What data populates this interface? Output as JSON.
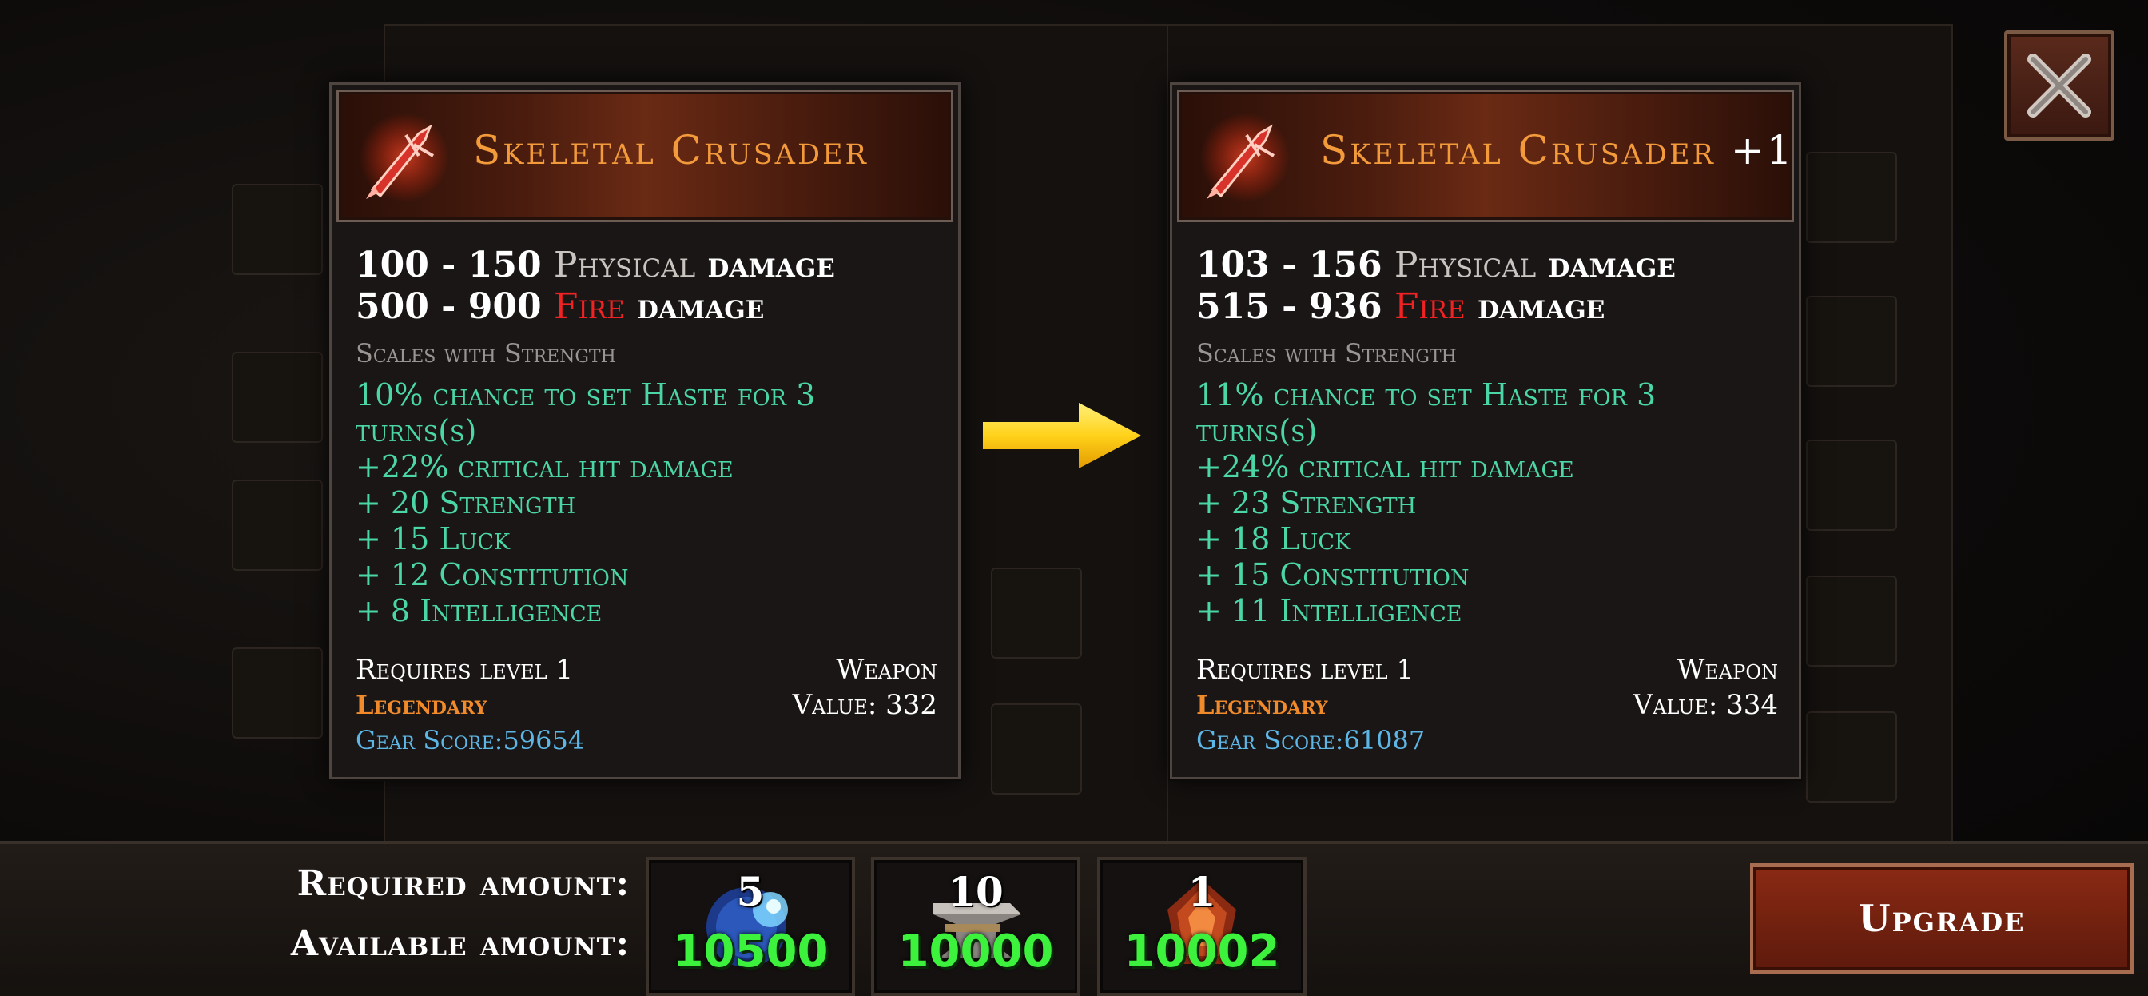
{
  "colors": {
    "title": "#f39a3a",
    "fire": "#f22222",
    "stat": "#4ad6a7",
    "legendary": "#f08a2a",
    "gear_score": "#5db7e6",
    "available": "#3cf23c"
  },
  "close_icon": "close-x-icon",
  "current_item": {
    "name": "Skeletal Crusader",
    "damage": [
      {
        "range": "100 - 150",
        "type": "Physical",
        "suffix": "damage"
      },
      {
        "range": "500 - 900",
        "type": "Fire",
        "suffix": "damage"
      }
    ],
    "scales": "Scales with Strength",
    "stats": [
      "10% chance to set Haste for 3",
      "turns(s)",
      "+22% critical hit damage",
      "+ 20 Strength",
      "+ 15 Luck",
      "+ 12 Constitution",
      "+ 8 Intelligence"
    ],
    "requires": "Requires level 1",
    "slot": "Weapon",
    "rarity": "Legendary",
    "value": "Value: 332",
    "gear_score": "Gear Score:59654"
  },
  "upgraded_item": {
    "name": "Skeletal Crusader",
    "plus": "+1",
    "damage": [
      {
        "range": "103 - 156",
        "type": "Physical",
        "suffix": "damage"
      },
      {
        "range": "515 - 936",
        "type": "Fire",
        "suffix": "damage"
      }
    ],
    "scales": "Scales with Strength",
    "stats": [
      "11% chance to set Haste for 3",
      "turns(s)",
      "+24% critical hit damage",
      "+ 23 Strength",
      "+ 18 Luck",
      "+ 15 Constitution",
      "+ 11 Intelligence"
    ],
    "requires": "Requires level 1",
    "slot": "Weapon",
    "rarity": "Legendary",
    "value": "Value: 334",
    "gear_score": "Gear Score:61087"
  },
  "cost": {
    "required_label": "Required amount:",
    "available_label": "Available amount:",
    "items": [
      {
        "icon": "blue-orb-icon",
        "required": "5",
        "available": "10500"
      },
      {
        "icon": "anvil-icon",
        "required": "10",
        "available": "10000"
      },
      {
        "icon": "fire-gem-icon",
        "required": "1",
        "available": "10002"
      }
    ]
  },
  "upgrade_label": "Upgrade"
}
